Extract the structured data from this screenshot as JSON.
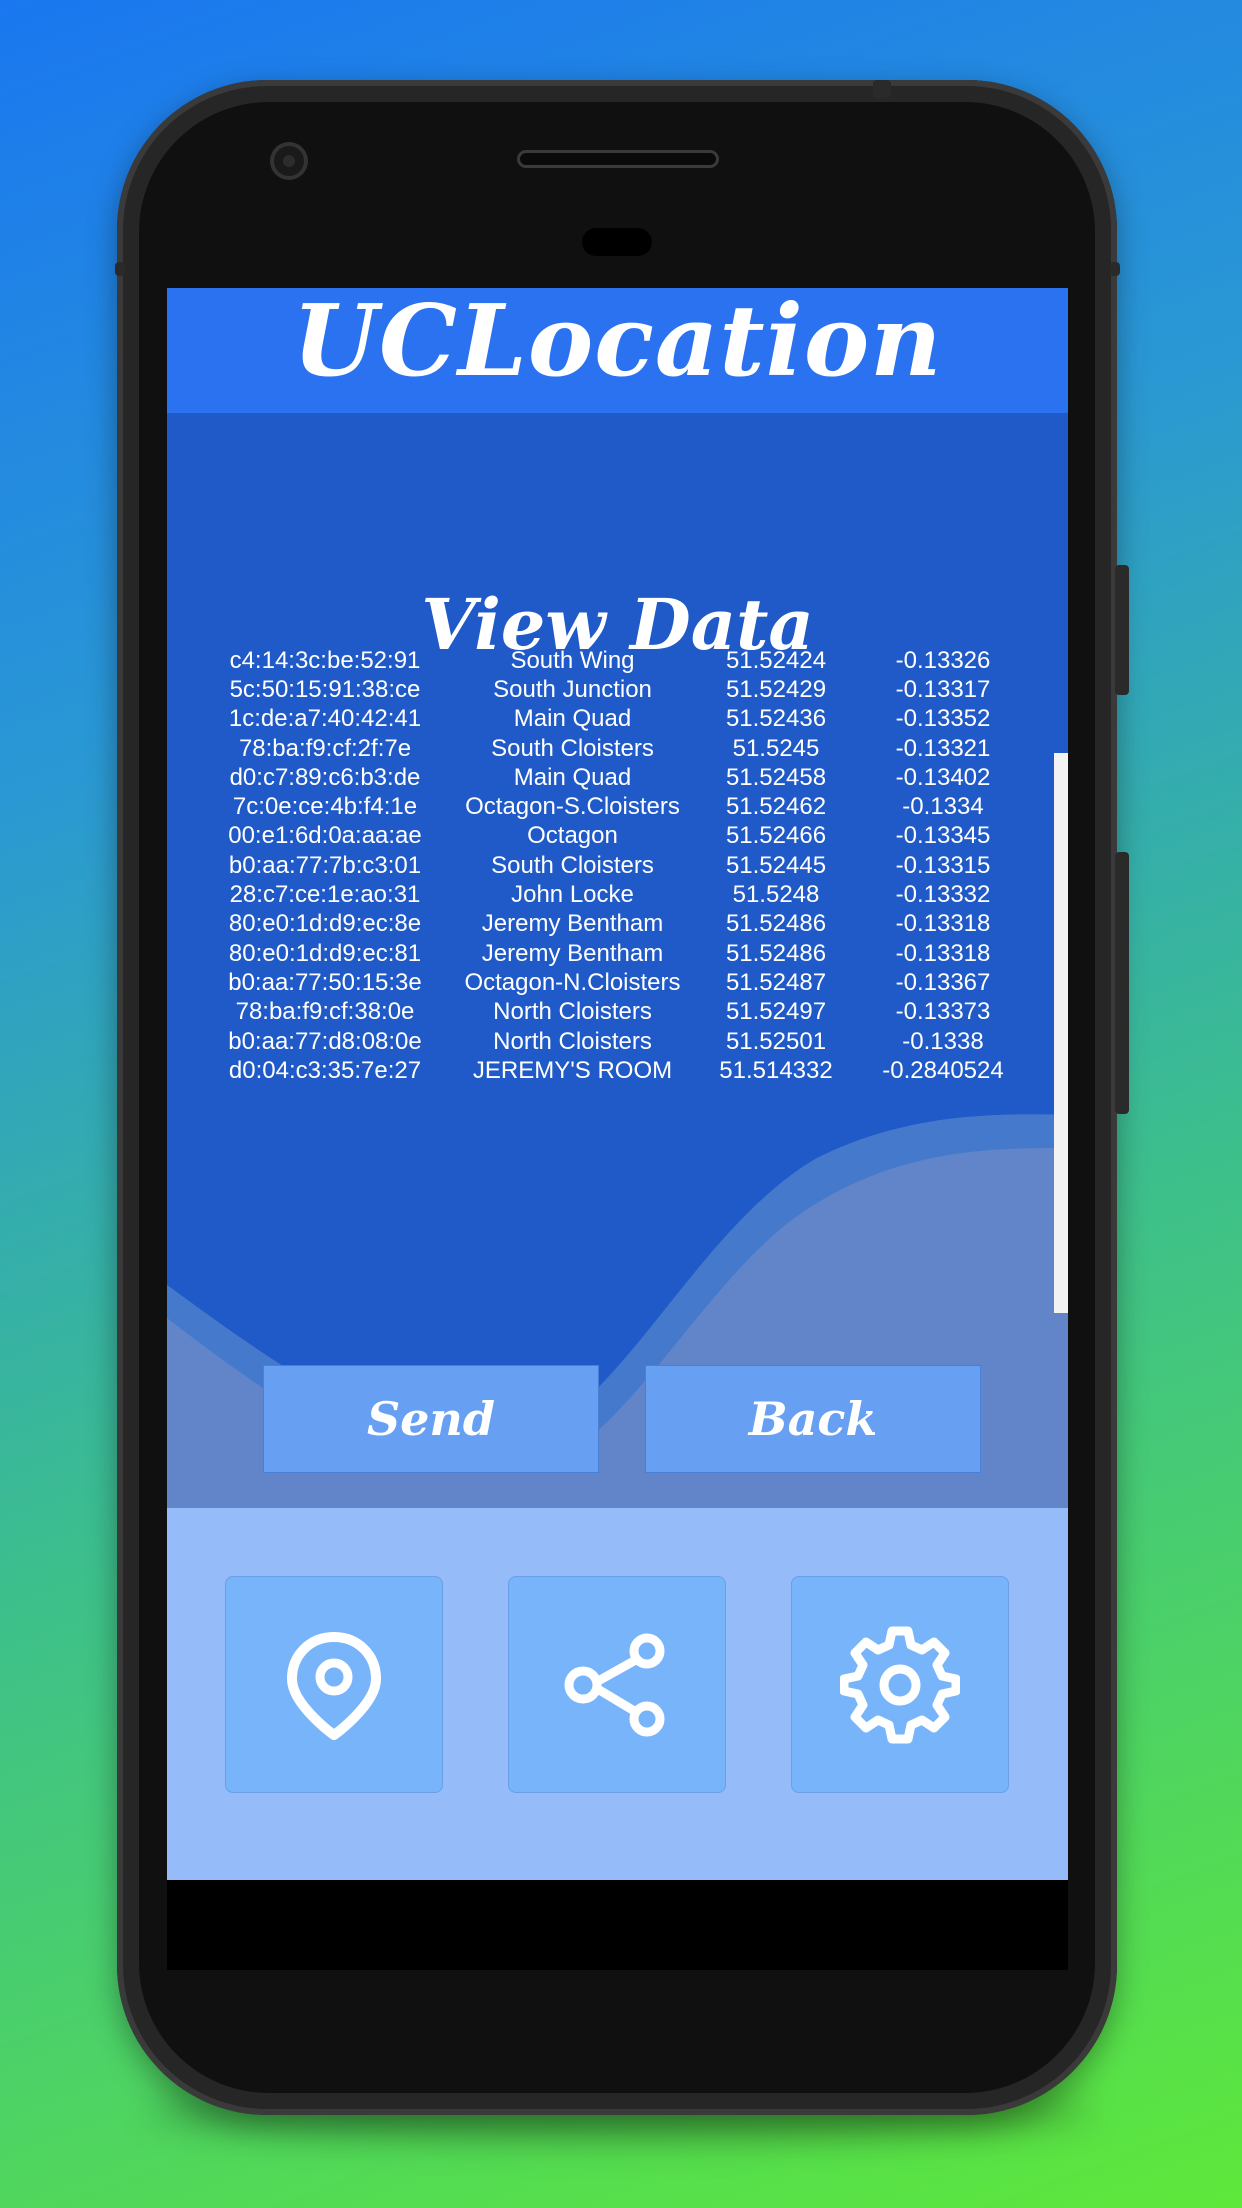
{
  "app": {
    "title": "UCLocation"
  },
  "view": {
    "title": "View Data"
  },
  "table": {
    "rows": [
      [
        "c4:14:3c:be:52:91",
        "South Wing",
        "51.52424",
        "-0.13326"
      ],
      [
        "5c:50:15:91:38:ce",
        "South Junction",
        "51.52429",
        "-0.13317"
      ],
      [
        "1c:de:a7:40:42:41",
        "Main Quad",
        "51.52436",
        "-0.13352"
      ],
      [
        "78:ba:f9:cf:2f:7e",
        "South Cloisters",
        "51.5245",
        "-0.13321"
      ],
      [
        "d0:c7:89:c6:b3:de",
        "Main Quad",
        "51.52458",
        "-0.13402"
      ],
      [
        "7c:0e:ce:4b:f4:1e",
        "Octagon-S.Cloisters",
        "51.52462",
        "-0.1334"
      ],
      [
        "00:e1:6d:0a:aa:ae",
        "Octagon",
        "51.52466",
        "-0.13345"
      ],
      [
        "b0:aa:77:7b:c3:01",
        "South Cloisters",
        "51.52445",
        "-0.13315"
      ],
      [
        "28:c7:ce:1e:ao:31",
        "John Locke",
        "51.5248",
        "-0.13332"
      ],
      [
        "80:e0:1d:d9:ec:8e",
        "Jeremy Bentham",
        "51.52486",
        "-0.13318"
      ],
      [
        "80:e0:1d:d9:ec:81",
        "Jeremy Bentham",
        "51.52486",
        "-0.13318"
      ],
      [
        "b0:aa:77:50:15:3e",
        "Octagon-N.Cloisters",
        "51.52487",
        "-0.13367"
      ],
      [
        "78:ba:f9:cf:38:0e",
        "North Cloisters",
        "51.52497",
        "-0.13373"
      ],
      [
        "b0:aa:77:d8:08:0e",
        "North Cloisters",
        "51.52501",
        "-0.1338"
      ],
      [
        "d0:04:c3:35:7e:27",
        "JEREMY'S ROOM",
        "51.514332",
        "-0.2840524"
      ]
    ]
  },
  "actions": {
    "send_label": "Send",
    "back_label": "Back"
  },
  "nav": {
    "items": [
      {
        "icon": "location-pin-icon"
      },
      {
        "icon": "share-icon"
      },
      {
        "icon": "settings-gear-icon"
      }
    ]
  },
  "colors": {
    "header": "#2a72f0",
    "main": "#1f5ac8",
    "button": "#679ff2",
    "nav_bar": "#96bbf9",
    "nav_button": "#78b4fa"
  }
}
